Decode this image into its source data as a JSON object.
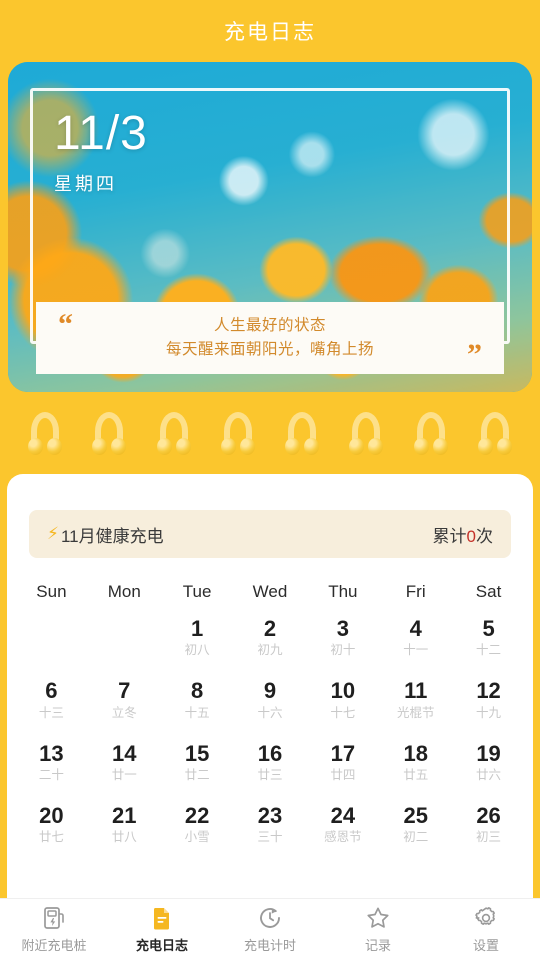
{
  "header": {
    "title": "充电日志"
  },
  "hero": {
    "date": "11/3",
    "weekday": "星期四",
    "quote_open": "“",
    "quote_close": "”",
    "quote_line1": "人生最好的状态",
    "quote_line2": "每天醒来面朝阳光，嘴角上扬"
  },
  "month_banner": {
    "bolt_icon": "⚡",
    "title": "11月健康充电",
    "total_prefix": "累计",
    "total_count": "0",
    "total_suffix": "次"
  },
  "calendar": {
    "weekdays": [
      "Sun",
      "Mon",
      "Tue",
      "Wed",
      "Thu",
      "Fri",
      "Sat"
    ],
    "days": [
      {
        "num": "",
        "lunar": ""
      },
      {
        "num": "",
        "lunar": ""
      },
      {
        "num": "1",
        "lunar": "初八"
      },
      {
        "num": "2",
        "lunar": "初九"
      },
      {
        "num": "3",
        "lunar": "初十"
      },
      {
        "num": "4",
        "lunar": "十一"
      },
      {
        "num": "5",
        "lunar": "十二"
      },
      {
        "num": "6",
        "lunar": "十三"
      },
      {
        "num": "7",
        "lunar": "立冬"
      },
      {
        "num": "8",
        "lunar": "十五"
      },
      {
        "num": "9",
        "lunar": "十六"
      },
      {
        "num": "10",
        "lunar": "十七"
      },
      {
        "num": "11",
        "lunar": "光棍节"
      },
      {
        "num": "12",
        "lunar": "十九"
      },
      {
        "num": "13",
        "lunar": "二十"
      },
      {
        "num": "14",
        "lunar": "廿一"
      },
      {
        "num": "15",
        "lunar": "廿二"
      },
      {
        "num": "16",
        "lunar": "廿三"
      },
      {
        "num": "17",
        "lunar": "廿四"
      },
      {
        "num": "18",
        "lunar": "廿五"
      },
      {
        "num": "19",
        "lunar": "廿六"
      },
      {
        "num": "20",
        "lunar": "廿七"
      },
      {
        "num": "21",
        "lunar": "廿八"
      },
      {
        "num": "22",
        "lunar": "小雪"
      },
      {
        "num": "23",
        "lunar": "三十"
      },
      {
        "num": "24",
        "lunar": "感恩节"
      },
      {
        "num": "25",
        "lunar": "初二"
      },
      {
        "num": "26",
        "lunar": "初三"
      }
    ]
  },
  "tabs": [
    {
      "label": "附近充电桩",
      "icon": "charging-station-icon",
      "active": false
    },
    {
      "label": "充电日志",
      "icon": "document-icon",
      "active": true
    },
    {
      "label": "充电计时",
      "icon": "timer-icon",
      "active": false
    },
    {
      "label": "记录",
      "icon": "star-icon",
      "active": false
    },
    {
      "label": "设置",
      "icon": "gear-icon",
      "active": false
    }
  ],
  "colors": {
    "background": "#FBC62D",
    "accent": "#F5B721",
    "count_red": "#C4322A",
    "quote_text": "#D28A2C",
    "sheet": "#FFFFFF"
  },
  "rings_count": 8
}
